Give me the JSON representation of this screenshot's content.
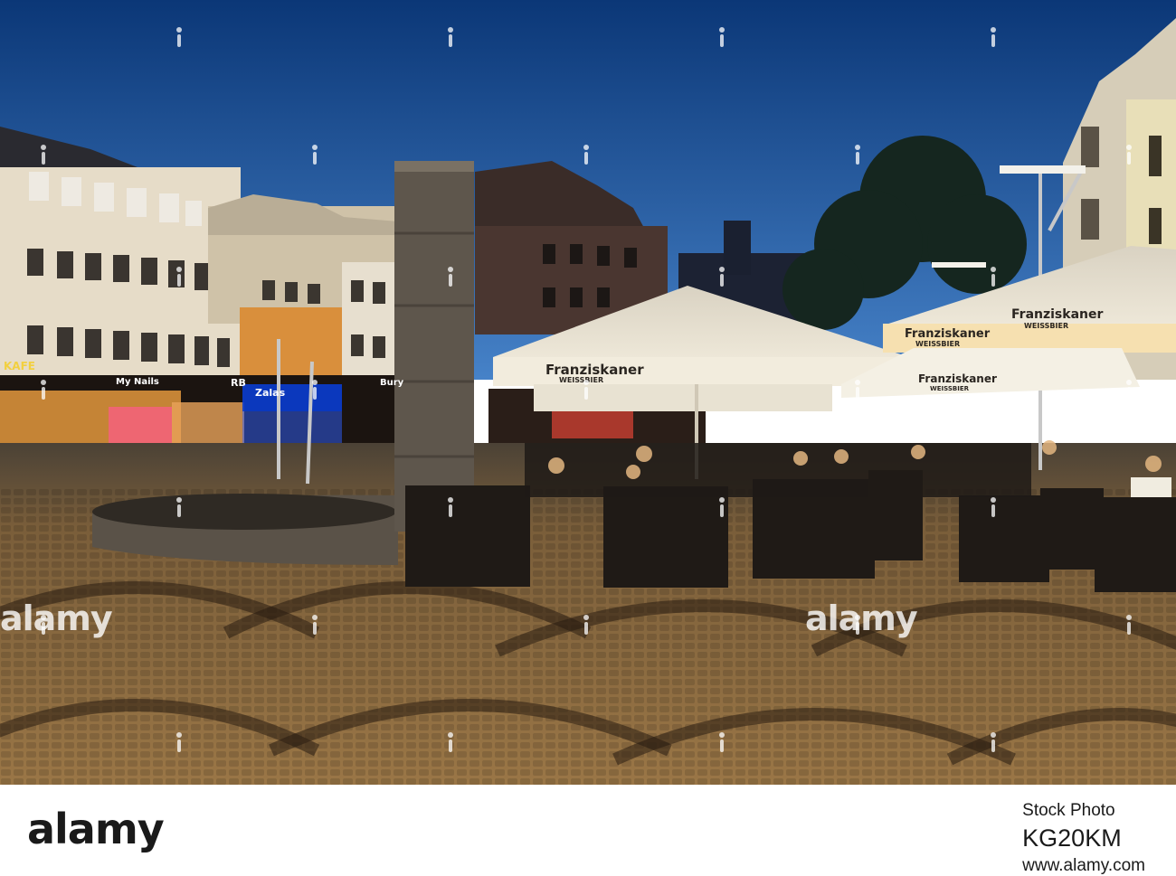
{
  "scene": {
    "colors": {
      "sky_top": "#0d3a7a",
      "sky_bottom": "#3f7cc4",
      "pavement": "#8a6a40",
      "umbrella": "#efe7d6",
      "building_warm": "#e9dcc4",
      "stone_pillar": "#5e564c"
    },
    "signs": {
      "franziskaner_1": "Franziskaner",
      "weissbier_1": "WEISSBIER",
      "franziskaner_2": "Franziskaner",
      "weissbier_2": "WEISSBIER",
      "franziskaner_3": "Franziskaner",
      "weissbier_3": "WEISSBIER",
      "franziskaner_4": "Franziskaner",
      "weissbier_4": "WEISSBIER",
      "cafe_sign": "KAFE",
      "shop_sign_1": "My Nails",
      "shop_sign_2": "Zalas",
      "shop_sign_3": "RB",
      "shop_sign_4": "Bury"
    }
  },
  "watermark": {
    "text_left": "alamy",
    "text_right": "alamy"
  },
  "footer": {
    "logo": "alamy",
    "stock_label": "Stock Photo",
    "image_id": "KG20KM",
    "url": "www.alamy.com"
  }
}
